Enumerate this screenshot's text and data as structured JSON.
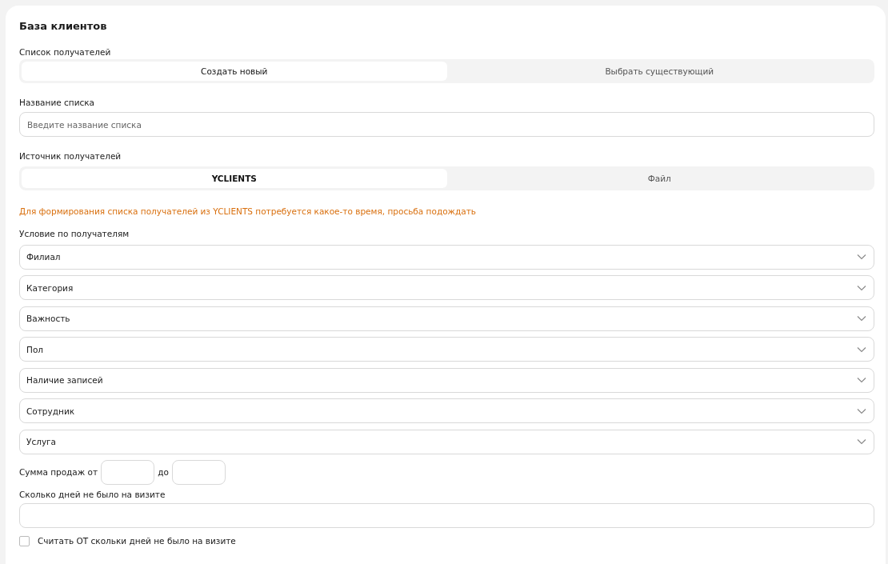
{
  "title": "База клиентов",
  "recipient_list": {
    "label": "Список получателей",
    "options": [
      {
        "label": "Создать новый",
        "selected": true
      },
      {
        "label": "Выбрать существующий",
        "selected": false
      }
    ]
  },
  "list_name": {
    "label": "Название списка",
    "placeholder": "Введите название списка"
  },
  "source": {
    "label": "Источник получателей",
    "options": [
      {
        "label": "YCLIENTS",
        "selected": true
      },
      {
        "label": "Файл",
        "selected": false
      }
    ]
  },
  "notice": "Для формирования списка получателей из YCLIENTS потребуется какое-то время, просьба подождать",
  "conditions": {
    "label": "Условие по получателям",
    "selects": [
      {
        "label": "Филиал"
      },
      {
        "label": "Категория"
      },
      {
        "label": "Важность"
      },
      {
        "label": "Пол"
      },
      {
        "label": "Наличие записей"
      },
      {
        "label": "Сотрудник"
      },
      {
        "label": "Услуга"
      }
    ]
  },
  "sales_sum": {
    "label_from": "Сумма продаж от",
    "label_to": "до"
  },
  "days_absent": {
    "label": "Сколько дней не было на визите"
  },
  "count_from": {
    "label": "Считать ОТ скольки дней не было на визите",
    "checked": false
  }
}
